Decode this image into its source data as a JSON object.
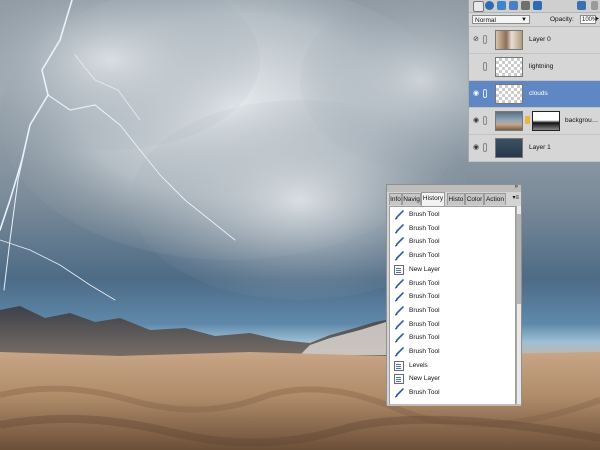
{
  "canvas": {
    "description_icon": "storm-clouds-lightning-desert"
  },
  "layers_panel": {
    "blend_mode": "Normal",
    "opacity_label": "Opacity:",
    "opacity_value": "100%",
    "layers": [
      {
        "name": "Layer 0",
        "selected": false,
        "visible_icon": "eye-slash-icon"
      },
      {
        "name": "lightning",
        "selected": false,
        "visible_icon": ""
      },
      {
        "name": "clouds",
        "selected": true,
        "visible_icon": "eye-icon"
      },
      {
        "name": "backgrou…",
        "selected": false,
        "visible_icon": "eye-icon"
      },
      {
        "name": "Layer 1",
        "selected": false,
        "visible_icon": "eye-icon"
      }
    ]
  },
  "history_panel": {
    "tabs": [
      "Info",
      "Navig",
      "History",
      "Histo",
      "Color",
      "Action"
    ],
    "active_tab": "History",
    "items": [
      "Brush Tool",
      "Brush Tool",
      "Brush Tool",
      "Brush Tool",
      "New Layer",
      "Brush Tool",
      "Brush Tool",
      "Brush Tool",
      "Brush Tool",
      "Brush Tool",
      "Brush Tool",
      "Levels",
      "New Layer",
      "Brush Tool"
    ],
    "item_icons": [
      "brush-icon",
      "brush-icon",
      "brush-icon",
      "brush-icon",
      "new-layer-icon",
      "brush-icon",
      "brush-icon",
      "brush-icon",
      "brush-icon",
      "brush-icon",
      "brush-icon",
      "levels-icon",
      "new-layer-icon",
      "brush-icon"
    ]
  },
  "colors": {
    "selection": "#5f87c4",
    "panel": "#d6d6d6"
  }
}
